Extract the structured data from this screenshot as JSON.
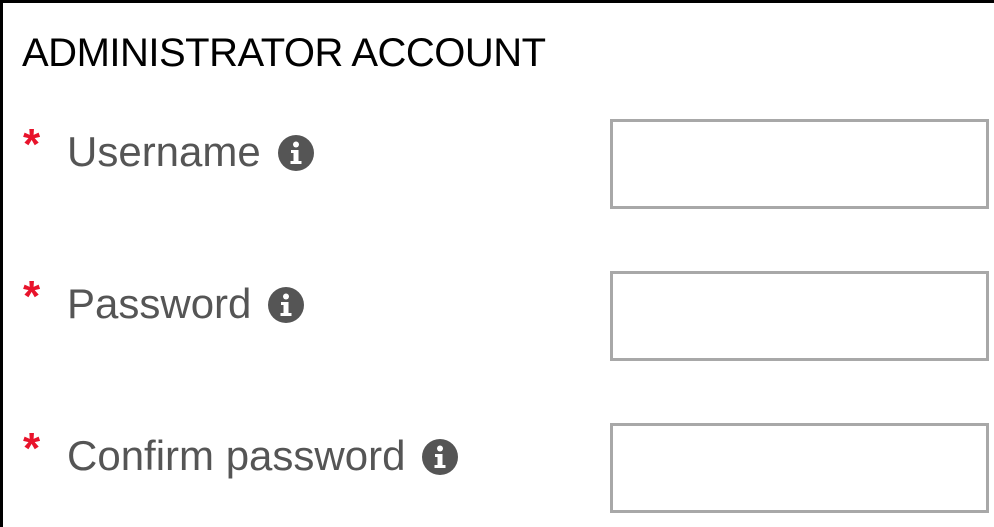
{
  "section": {
    "title": "ADMINISTRATOR ACCOUNT"
  },
  "fields": [
    {
      "required_mark": "*",
      "label": "Username",
      "value": "",
      "info_icon": "info-circle-icon"
    },
    {
      "required_mark": "*",
      "label": "Password",
      "value": "",
      "info_icon": "info-circle-icon"
    },
    {
      "required_mark": "*",
      "label": "Confirm password",
      "value": "",
      "info_icon": "info-circle-icon"
    }
  ],
  "colors": {
    "required": "#e8132b",
    "label": "#555555",
    "input_border": "#a8a8a8",
    "icon": "#555555"
  }
}
